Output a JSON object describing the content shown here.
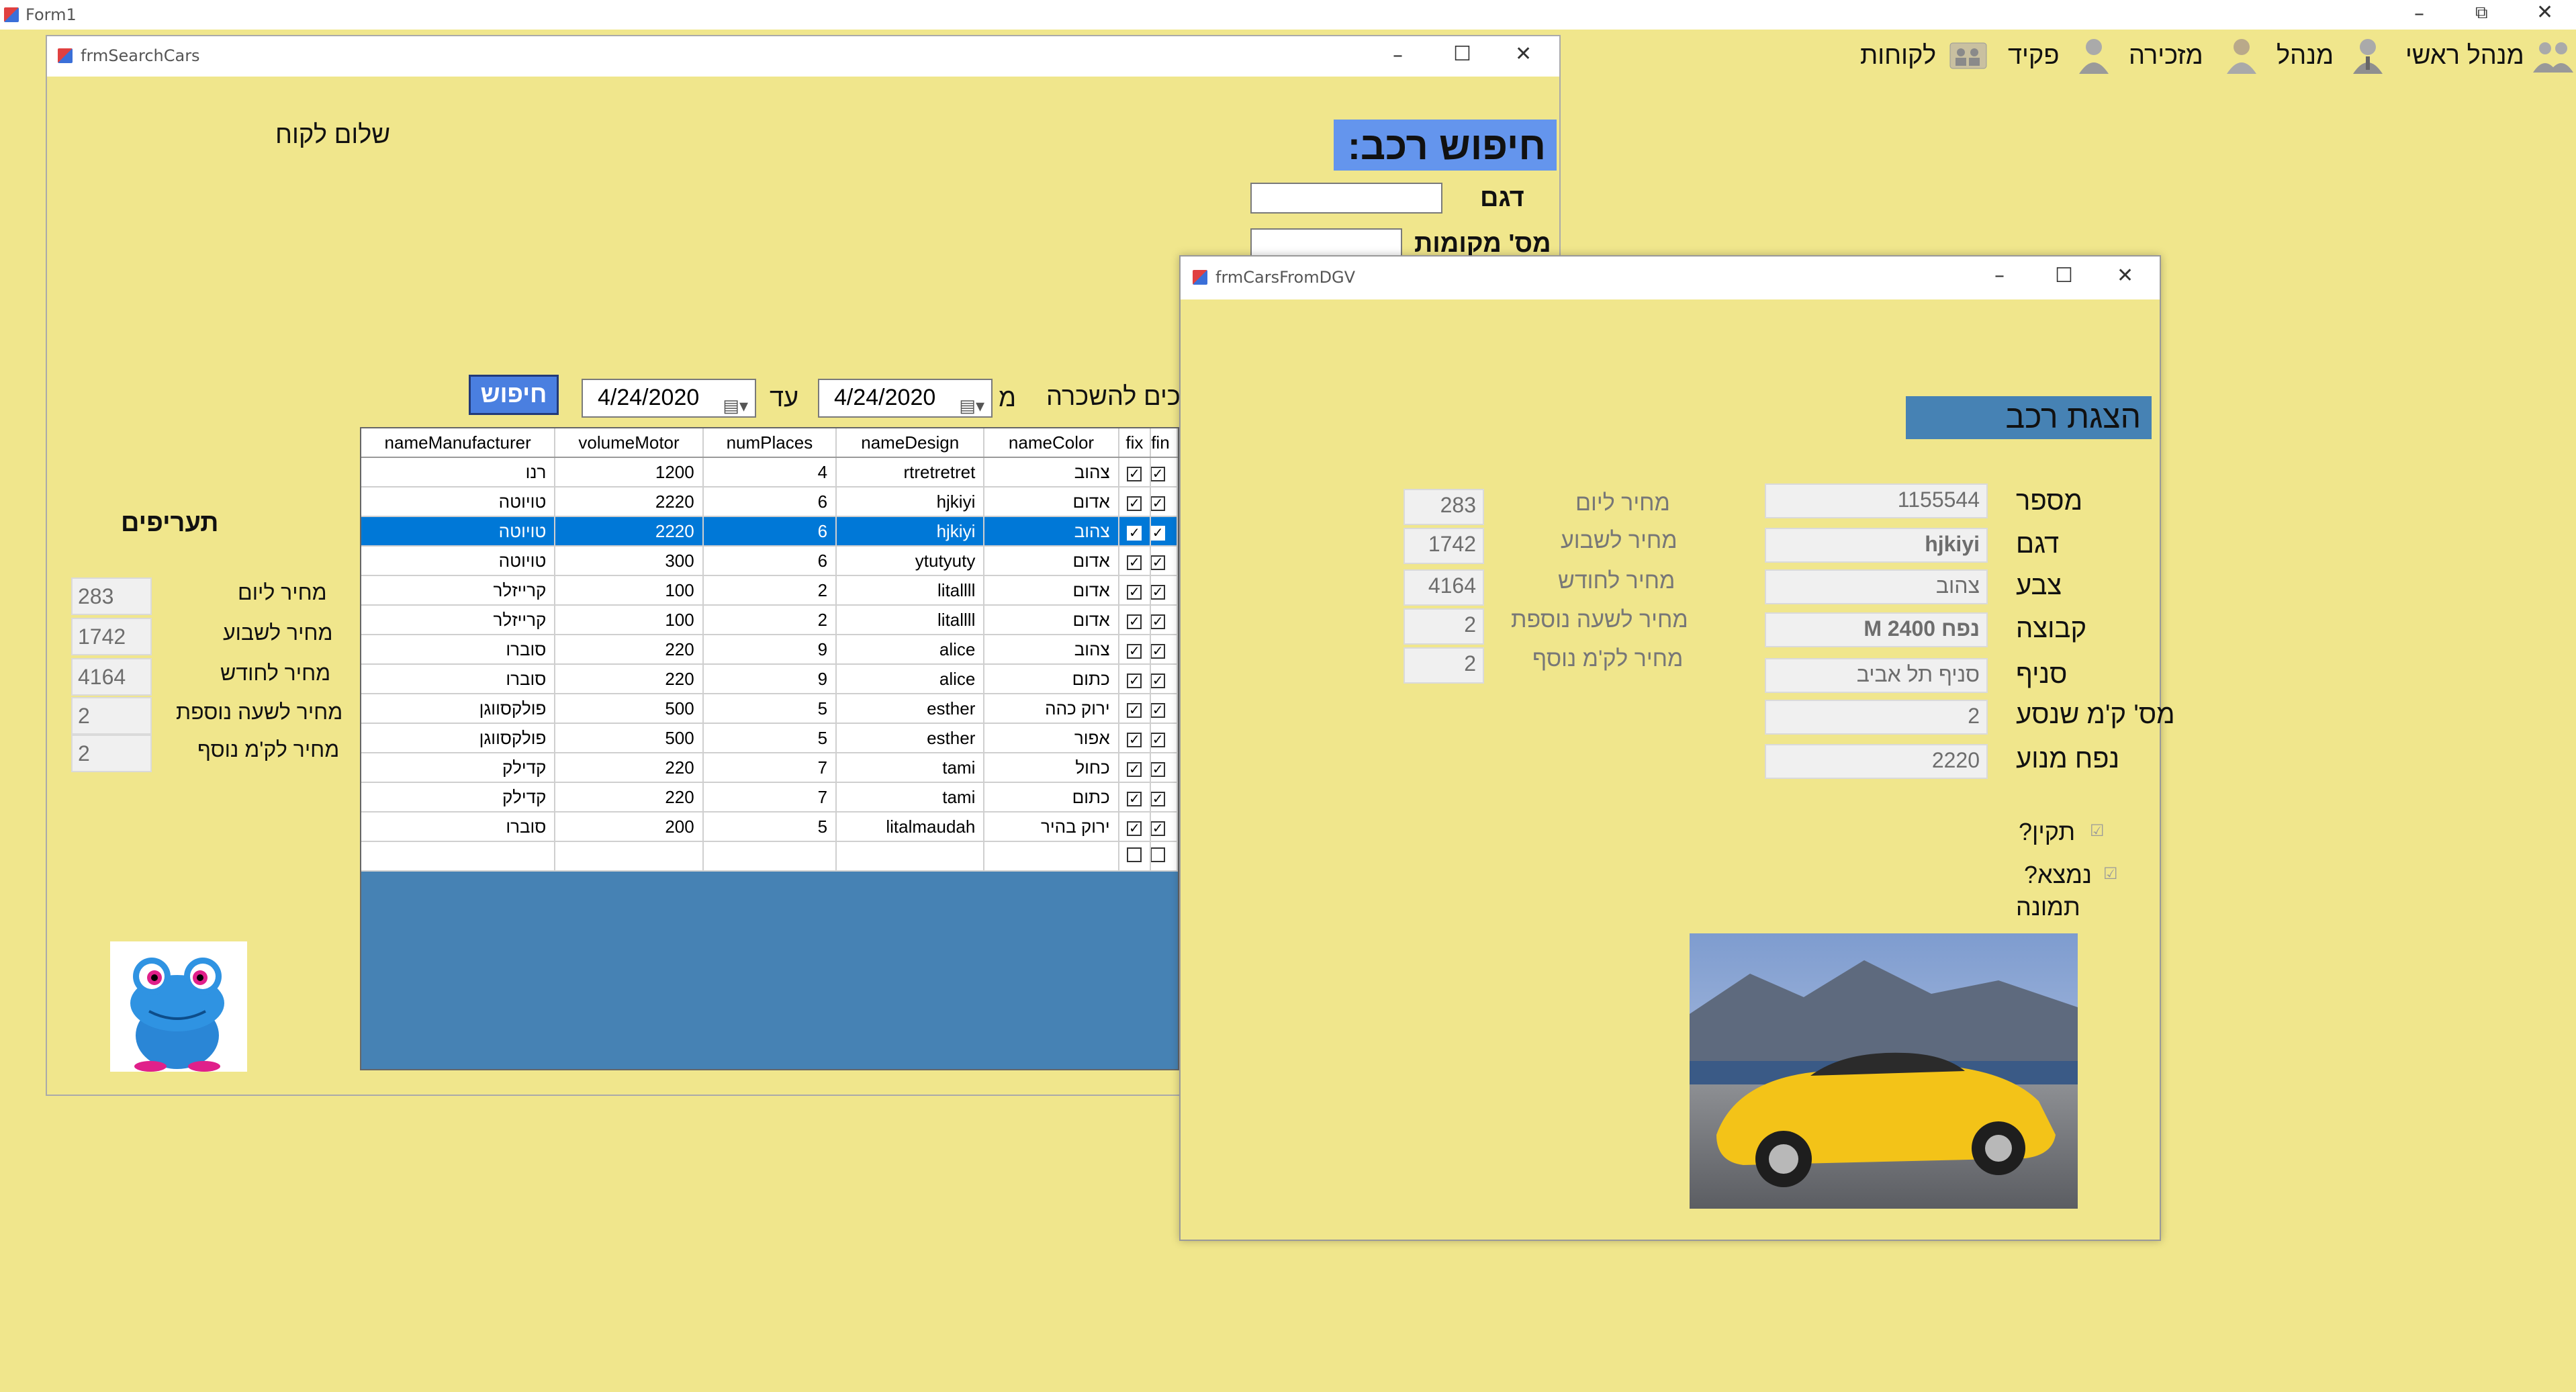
{
  "main_window": {
    "title": "Form1",
    "menu": [
      {
        "label": "לקוחות",
        "icon": "customers-icon"
      },
      {
        "label": "פקיד",
        "icon": "clerk-icon"
      },
      {
        "label": "מזכירה",
        "icon": "secretary-icon"
      },
      {
        "label": "מנהל",
        "icon": "manager-icon"
      },
      {
        "label": "מנהל ראשי",
        "icon": "head-manager-icon"
      }
    ]
  },
  "search_form": {
    "title": "frmSearchCars",
    "greeting": "שלום לקוח",
    "heading": "חיפוש רכב:",
    "model_label": "דגם",
    "seats_label": "מס' מקומות",
    "available_label": "כים להשכרה",
    "from_label": "מ",
    "to_label": "עד",
    "from_date": "4/24/2020",
    "to_date": "4/24/2020",
    "search_button": "חיפוש",
    "rates": {
      "title": "תעריפים",
      "daily_label": "מחיר ליום",
      "daily": "283",
      "weekly_label": "מחיר לשבוע",
      "weekly": "1742",
      "monthly_label": "מחיר לחודש",
      "monthly": "4164",
      "extra_hour_label": "מחיר לשעה נוספת",
      "extra_hour": "2",
      "extra_km_label": "מחיר לק'מ נוסף",
      "extra_km": "2"
    },
    "grid": {
      "columns": [
        "nameManufacturer",
        "volumeMotor",
        "numPlaces",
        "nameDesign",
        "nameColor",
        "fix",
        "fin"
      ],
      "rows": [
        {
          "manufacturer": "רנו",
          "motor": "1200",
          "places": "4",
          "design": "rtretretret",
          "color": "צהוב",
          "fix": true,
          "selected": false
        },
        {
          "manufacturer": "טויוטה",
          "motor": "2220",
          "places": "6",
          "design": "hjkiyi",
          "color": "אדום",
          "fix": true,
          "selected": false
        },
        {
          "manufacturer": "טויוטה",
          "motor": "2220",
          "places": "6",
          "design": "hjkiyi",
          "color": "צהוב",
          "fix": true,
          "selected": true
        },
        {
          "manufacturer": "טויוטה",
          "motor": "300",
          "places": "6",
          "design": "ytutyuty",
          "color": "אדום",
          "fix": true,
          "selected": false
        },
        {
          "manufacturer": "קרייזלר",
          "motor": "100",
          "places": "2",
          "design": "litallll",
          "color": "אדום",
          "fix": true,
          "selected": false
        },
        {
          "manufacturer": "קרייזלר",
          "motor": "100",
          "places": "2",
          "design": "litallll",
          "color": "אדום",
          "fix": true,
          "selected": false
        },
        {
          "manufacturer": "סוברו",
          "motor": "220",
          "places": "9",
          "design": "alice",
          "color": "צהוב",
          "fix": true,
          "selected": false
        },
        {
          "manufacturer": "סוברו",
          "motor": "220",
          "places": "9",
          "design": "alice",
          "color": "כתום",
          "fix": true,
          "selected": false
        },
        {
          "manufacturer": "פולקסווגן",
          "motor": "500",
          "places": "5",
          "design": "esther",
          "color": "ירוק כהה",
          "fix": true,
          "selected": false
        },
        {
          "manufacturer": "פולקסווגן",
          "motor": "500",
          "places": "5",
          "design": "esther",
          "color": "אפור",
          "fix": true,
          "selected": false
        },
        {
          "manufacturer": "קדילק",
          "motor": "220",
          "places": "7",
          "design": "tami",
          "color": "כחול",
          "fix": true,
          "selected": false
        },
        {
          "manufacturer": "קדילק",
          "motor": "220",
          "places": "7",
          "design": "tami",
          "color": "כתום",
          "fix": true,
          "selected": false
        },
        {
          "manufacturer": "סוברו",
          "motor": "200",
          "places": "5",
          "design": "litalmaudah",
          "color": "ירוק בהיר",
          "fix": true,
          "selected": false
        }
      ]
    }
  },
  "car_form": {
    "title": "frmCarsFromDGV",
    "heading": "הצגת רכב",
    "number_label": "מספר",
    "number": "1155544",
    "model_label": "דגם",
    "model": "hjkiyi",
    "color_label": "צבע",
    "color": "צהוב",
    "group_label": "קבוצה",
    "group": "M נפח 2400",
    "branch_label": "סניף",
    "branch": "סניף תל אביב",
    "km_label": "מס' ק'מ שנסע",
    "km": "2",
    "engine_label": "נפח מנוע",
    "engine": "2220",
    "fixed_label": "תקין?",
    "found_label": "נמצא?",
    "image_label": "תמונה",
    "daily_label": "מחיר ליום",
    "daily": "283",
    "weekly_label": "מחיר לשבוע",
    "weekly": "1742",
    "monthly_label": "מחיר לחודש",
    "monthly": "4164",
    "extra_hour_label": "מחיר לשעה נוספת",
    "extra_hour": "2",
    "extra_km_label": "מחיר לק'מ נוסף",
    "extra_km": "2"
  },
  "colors": {
    "background": "#f0e68c",
    "heading_blue": "#6495ed",
    "steel_blue": "#4682b4",
    "selection": "#0078d7"
  }
}
